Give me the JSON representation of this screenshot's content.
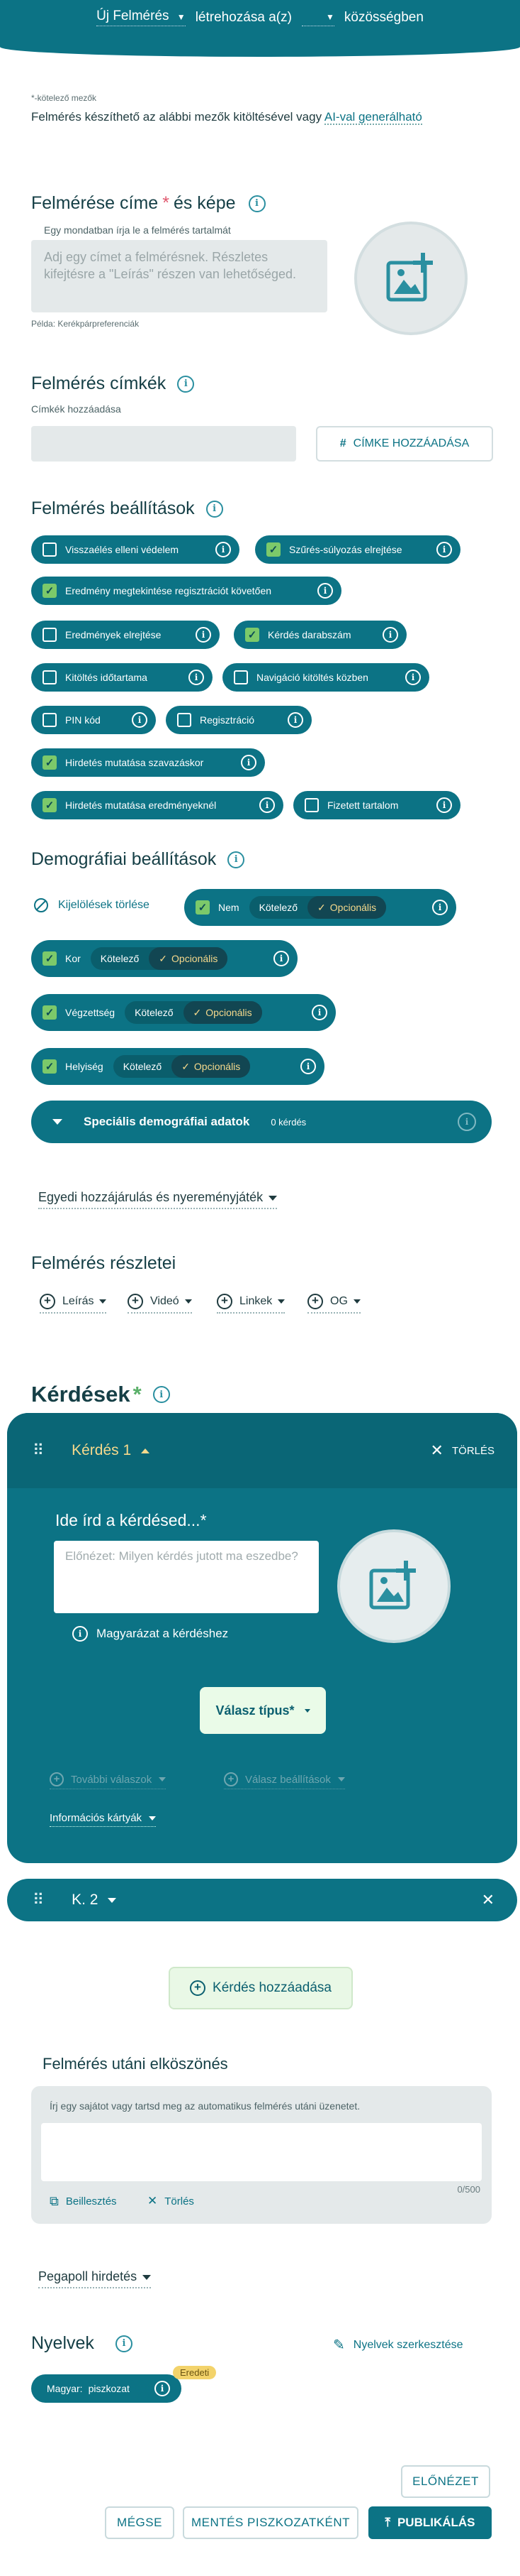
{
  "header": {
    "type_select": "Új Felmérés",
    "create_text": "létrehozása a(z)",
    "community_select": "",
    "community_text": "közösségben"
  },
  "intro": {
    "required_note": "*-kötelező mezők",
    "text": "Felmérés készíthető az alábbi mezők kitöltésével vagy",
    "ai_link": "AI-val generálható"
  },
  "title_section": {
    "heading": "Felmérése címe",
    "heading_tail": "és képe",
    "hint": "Egy mondatban írja le a felmérés tartalmát",
    "placeholder": "Adj egy címet a felmérésnek. Részletes kifejtésre a \"Leírás\" részen van lehetőséged.",
    "example": "Példa: Kerékpárpreferenciák"
  },
  "tags_section": {
    "heading": "Felmérés címkék",
    "label": "Címkék hozzáadása",
    "button": "CÍMKE HOZZÁADÁSA"
  },
  "settings_section": {
    "heading": "Felmérés beállítások",
    "options": [
      {
        "label": "Visszaélés elleni védelem",
        "checked": false
      },
      {
        "label": "Szűrés-súlyozás elrejtése",
        "checked": true
      },
      {
        "label": "Eredmény megtekintése regisztrációt követően",
        "checked": true
      },
      {
        "label": "Eredmények elrejtése",
        "checked": false
      },
      {
        "label": "Kérdés darabszám",
        "checked": true
      },
      {
        "label": "Kitöltés időtartama",
        "checked": false
      },
      {
        "label": "Navigáció kitöltés közben",
        "checked": false
      },
      {
        "label": "PIN kód",
        "checked": false
      },
      {
        "label": "Regisztráció",
        "checked": false
      },
      {
        "label": "Hirdetés mutatása szavazáskor",
        "checked": true
      },
      {
        "label": "Hirdetés mutatása eredményeknél",
        "checked": true
      },
      {
        "label": "Fizetett tartalom",
        "checked": false
      }
    ]
  },
  "demo_section": {
    "heading": "Demográfiai beállítások",
    "clear": "Kijelölések törlése",
    "required_label": "Kötelező",
    "optional_label": "Opcionális",
    "items": [
      "Nem",
      "Kor",
      "Végzettség",
      "Helyiség"
    ],
    "special": "Speciális demográfiai adatok",
    "special_count": "0 kérdés"
  },
  "consent": "Egyedi hozzájárulás és nyereményjáték",
  "details": {
    "heading": "Felmérés részletei",
    "items": [
      "Leírás",
      "Videó",
      "Linkek",
      "OG"
    ]
  },
  "questions": {
    "heading": "Kérdések",
    "q1_title": "Kérdés 1",
    "delete": "TÖRLÉS",
    "prompt": "Ide írd a kérdésed...*",
    "placeholder": "Előnézet: Milyen kérdés jutott ma eszedbe?",
    "explain": "Magyarázat a kérdéshez",
    "answer_type": "Válasz típus*",
    "more_answers": "További válaszok",
    "answer_settings": "Válasz beállítások",
    "info_cards": "Információs kártyák",
    "q2_title": "K. 2",
    "add": "Kérdés hozzáadása"
  },
  "farewell": {
    "heading": "Felmérés utáni elköszönés",
    "hint": "Írj egy sajátot vagy tartsd meg az automatikus felmérés utáni üzenetet.",
    "counter": "0/500",
    "paste": "Beillesztés",
    "clear": "Törlés"
  },
  "pegapoll_ad": "Pegapoll hirdetés",
  "languages": {
    "heading": "Nyelvek",
    "edit": "Nyelvek szerkesztése",
    "badge": "Eredeti",
    "lang_label": "Magyar:",
    "lang_value": "piszkozat"
  },
  "footer": {
    "preview": "ELŐNÉZET",
    "cancel": "MÉGSE",
    "save_draft": "MENTÉS PISZKOZATKÉNT",
    "publish": "PUBLIKÁLÁS"
  },
  "colors": {
    "primary": "#0c7385",
    "accent_green": "#7cc96a",
    "optional_text": "#f6d98c",
    "badge": "#f3d36b"
  }
}
